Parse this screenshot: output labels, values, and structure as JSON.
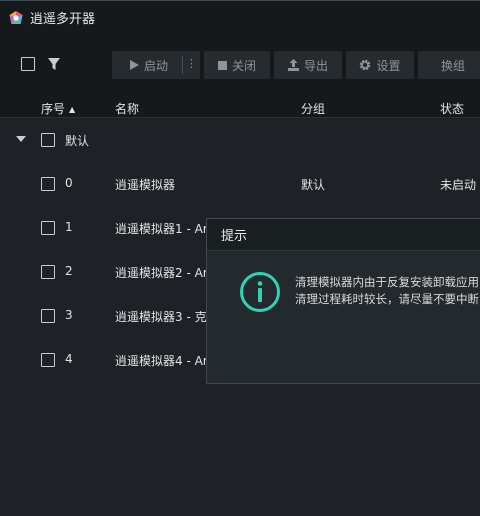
{
  "app": {
    "title": "逍遥多开器",
    "logo_icon": "app-logo-icon"
  },
  "toolbar": {
    "start_label": "启动",
    "close_label": "关闭",
    "export_label": "导出",
    "settings_label": "设置",
    "switch_label": "换组",
    "more_label": "⋮"
  },
  "table": {
    "headers": {
      "index": "序号",
      "name": "名称",
      "group": "分组",
      "status": "状态"
    }
  },
  "group": {
    "name": "默认"
  },
  "rows": [
    {
      "index": "0",
      "name": "逍遥模拟器",
      "group": "默认",
      "status": "未启动"
    },
    {
      "index": "1",
      "name": "逍遥模拟器1 - Ar",
      "group": "",
      "status": ""
    },
    {
      "index": "2",
      "name": "逍遥模拟器2 - Ar",
      "group": "",
      "status": ""
    },
    {
      "index": "3",
      "name": "逍遥模拟器3 - 克",
      "group": "",
      "status": ""
    },
    {
      "index": "4",
      "name": "逍遥模拟器4 - Ar",
      "group": "",
      "status": ""
    }
  ],
  "dialog": {
    "title": "提示",
    "line1": "清理模拟器内由于反复安装卸载应用",
    "line2": "清理过程耗时较长，请尽量不要中断"
  },
  "colors": {
    "accent": "#2ed3b7",
    "background": "#1e2226",
    "toolbar": "#15191c"
  }
}
